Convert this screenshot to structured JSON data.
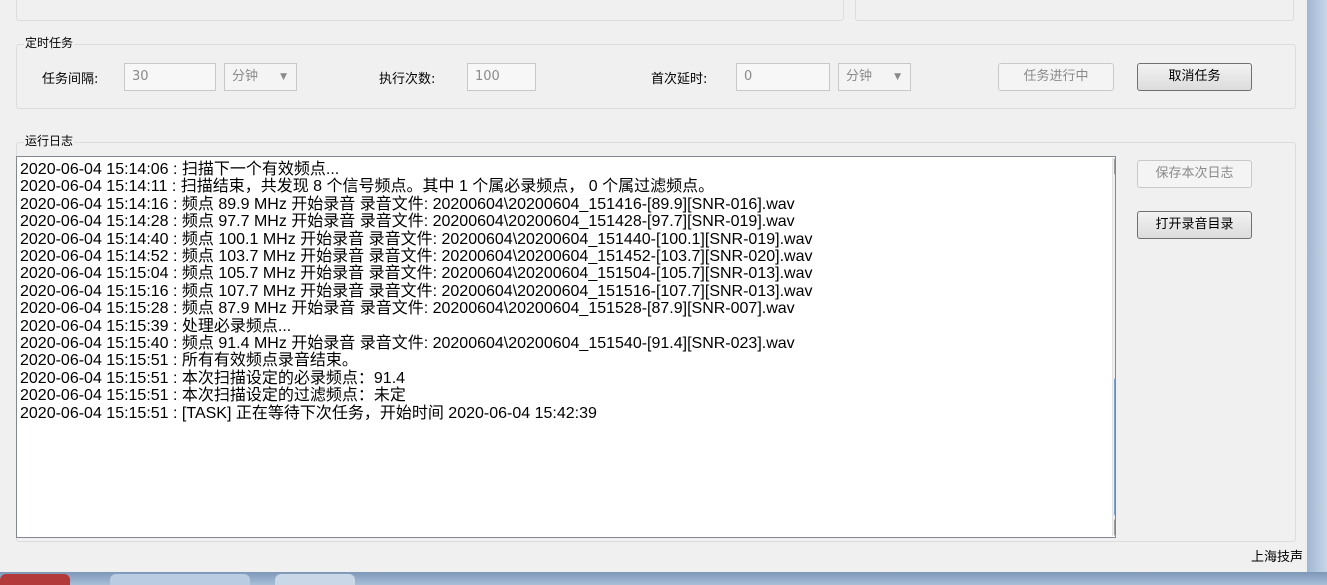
{
  "timer_task": {
    "title": "定时任务",
    "interval_label": "任务间隔:",
    "interval_value": "30",
    "interval_unit": "分钟",
    "exec_count_label": "执行次数:",
    "exec_count_value": "100",
    "first_delay_label": "首次延时:",
    "first_delay_value": "0",
    "first_delay_unit": "分钟",
    "task_running_button": "任务进行中",
    "cancel_task_button": "取消任务"
  },
  "run_log": {
    "title": "运行日志",
    "save_log_button": "保存本次日志",
    "open_record_dir_button": "打开录音目录",
    "lines": [
      "2020-06-04 15:14:06 : 扫描下一个有效频点...",
      "2020-06-04 15:14:11 : 扫描结束，共发现 8 个信号频点。其中 1 个属必录频点， 0 个属过滤频点。",
      "2020-06-04 15:14:16 : 频点 89.9 MHz 开始录音 录音文件: 20200604\\20200604_151416-[89.9][SNR-016].wav",
      "2020-06-04 15:14:28 : 频点 97.7 MHz 开始录音 录音文件: 20200604\\20200604_151428-[97.7][SNR-019].wav",
      "2020-06-04 15:14:40 : 频点 100.1 MHz 开始录音 录音文件: 20200604\\20200604_151440-[100.1][SNR-019].wav",
      "2020-06-04 15:14:52 : 频点 103.7 MHz 开始录音 录音文件: 20200604\\20200604_151452-[103.7][SNR-020].wav",
      "2020-06-04 15:15:04 : 频点 105.7 MHz 开始录音 录音文件: 20200604\\20200604_151504-[105.7][SNR-013].wav",
      "2020-06-04 15:15:16 : 频点 107.7 MHz 开始录音 录音文件: 20200604\\20200604_151516-[107.7][SNR-013].wav",
      "2020-06-04 15:15:28 : 频点 87.9 MHz 开始录音 录音文件: 20200604\\20200604_151528-[87.9][SNR-007].wav",
      "2020-06-04 15:15:39 : 处理必录频点...",
      "2020-06-04 15:15:40 : 频点 91.4 MHz 开始录音 录音文件: 20200604\\20200604_151540-[91.4][SNR-023].wav",
      "2020-06-04 15:15:51 : 所有有效频点录音结束。",
      "2020-06-04 15:15:51 : 本次扫描设定的必录频点：91.4",
      "2020-06-04 15:15:51 : 本次扫描设定的过滤频点：未定",
      "2020-06-04 15:15:51 : [TASK] 正在等待下次任务，开始时间 2020-06-04 15:42:39"
    ]
  },
  "footer": {
    "brand": "上海技声"
  }
}
